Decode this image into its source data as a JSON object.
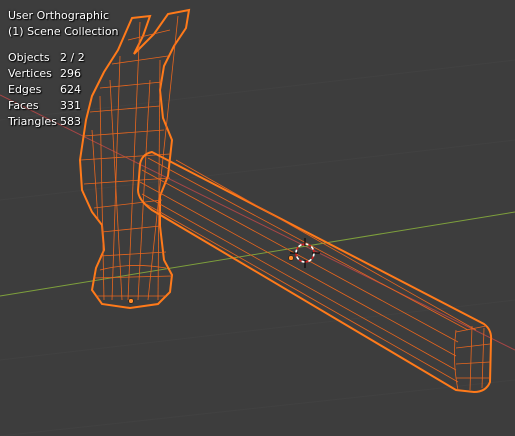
{
  "viewport": {
    "view_name": "User Orthographic",
    "collection": "(1) Scene Collection"
  },
  "statistics": [
    {
      "label": "Objects",
      "value": "2 / 2"
    },
    {
      "label": "Vertices",
      "value": "296"
    },
    {
      "label": "Edges",
      "value": "624"
    },
    {
      "label": "Faces",
      "value": "331"
    },
    {
      "label": "Triangles",
      "value": "583"
    }
  ],
  "colors": {
    "background": "#3d3d3d",
    "grid_line": "#444444",
    "x_axis": "#a84646",
    "y_axis": "#7ea03c",
    "selection_outline": "#ff7a1a",
    "wire": "#e8661e",
    "text": "#ffffff"
  }
}
